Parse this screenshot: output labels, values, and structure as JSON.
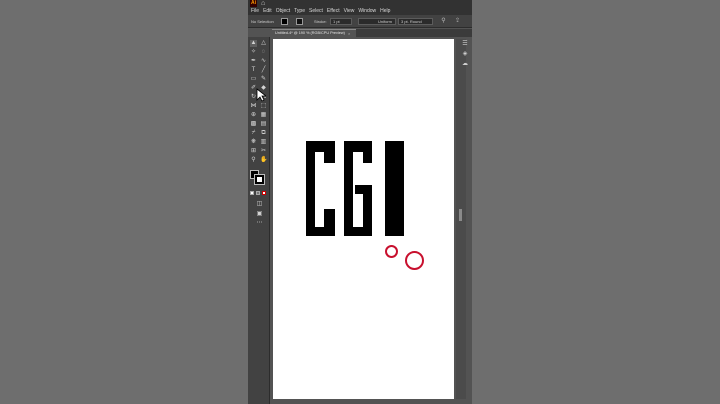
{
  "app": {
    "logo_text": "Ai",
    "home_icon": "home-icon",
    "menu": [
      "File",
      "Edit",
      "Object",
      "Type",
      "Select",
      "Effect",
      "View",
      "Window",
      "Help"
    ]
  },
  "control_bar": {
    "selection_status": "No Selection",
    "stroke_label": "Stroke:",
    "stroke_weight": "1 pt",
    "profile": "Uniform",
    "brush": "3 pt. Round"
  },
  "document_tab": {
    "title": "Untitled-4* @ 190 % (RGB/CPU Preview)",
    "close_glyph": "×"
  },
  "artwork": {
    "letters": "CGI",
    "fill_color": "#000000"
  },
  "colors": {
    "ui_dark": "#323232",
    "ui_panel": "#424242",
    "ui_workspace": "#535353",
    "click_indicator": "#c8102e"
  }
}
